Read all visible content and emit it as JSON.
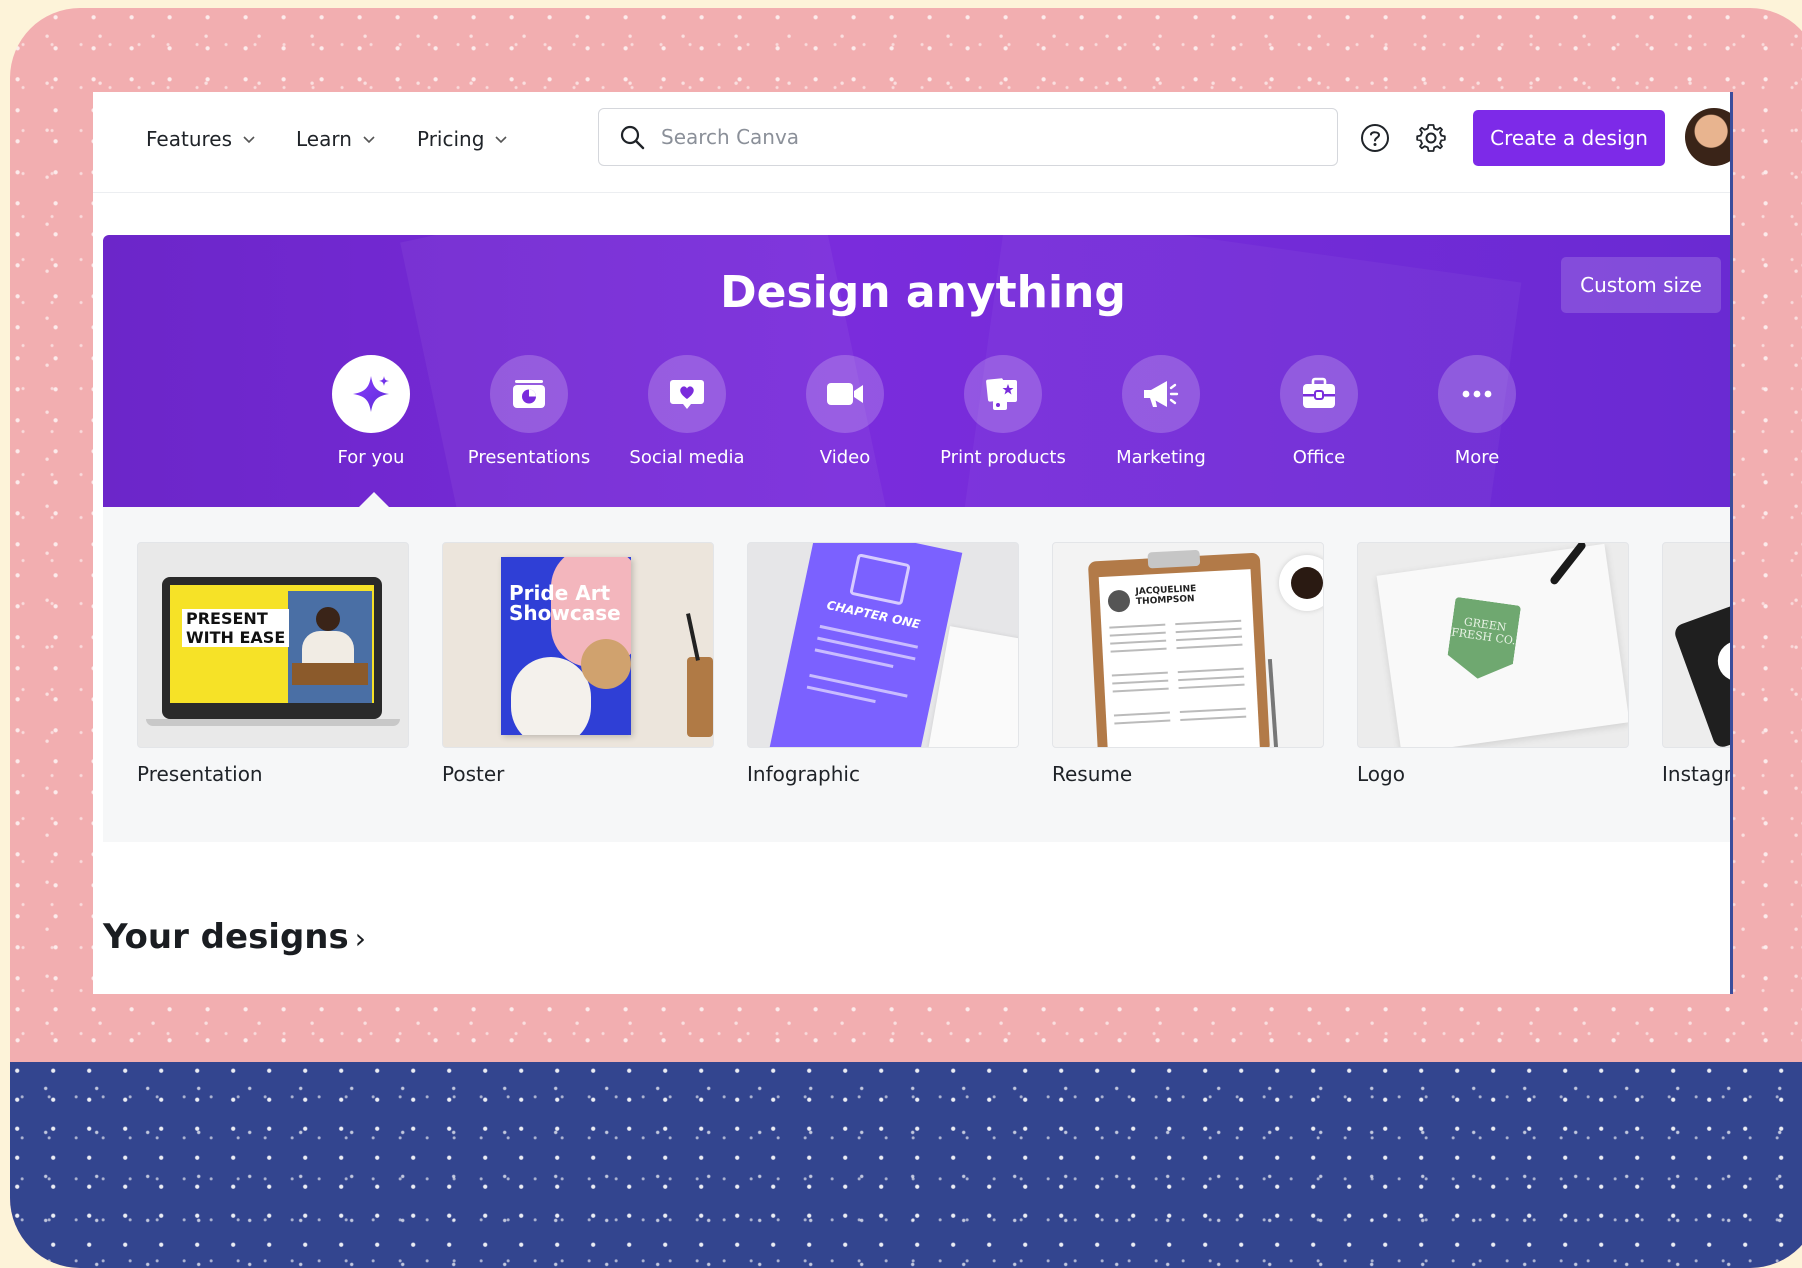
{
  "nav": {
    "items": [
      {
        "label": "Features"
      },
      {
        "label": "Learn"
      },
      {
        "label": "Pricing"
      }
    ]
  },
  "search": {
    "placeholder": "Search Canva",
    "value": ""
  },
  "header": {
    "create_label": "Create a design"
  },
  "hero": {
    "title": "Design anything",
    "custom_size_label": "Custom size",
    "categories": [
      {
        "label": "For you",
        "icon": "sparkle-icon",
        "active": true
      },
      {
        "label": "Presentations",
        "icon": "presentation-icon"
      },
      {
        "label": "Social media",
        "icon": "heart-chat-icon"
      },
      {
        "label": "Video",
        "icon": "video-camera-icon"
      },
      {
        "label": "Print products",
        "icon": "print-products-icon"
      },
      {
        "label": "Marketing",
        "icon": "megaphone-icon"
      },
      {
        "label": "Office",
        "icon": "briefcase-icon"
      },
      {
        "label": "More",
        "icon": "more-dots-icon"
      }
    ]
  },
  "templates": [
    {
      "label": "Presentation",
      "thumb_text": "PRESENT\nWITH EASE"
    },
    {
      "label": "Poster",
      "thumb_text": "Pride Art\nShowcase"
    },
    {
      "label": "Infographic",
      "thumb_text": "CHAPTER ONE"
    },
    {
      "label": "Resume",
      "thumb_text": "JACQUELINE\nTHOMPSON"
    },
    {
      "label": "Logo",
      "thumb_text": "GREEN\nFRESH CO."
    },
    {
      "label": "Instagram"
    }
  ],
  "your_designs": {
    "title": "Your designs",
    "chevron": "›"
  },
  "colors": {
    "accent": "#7d2ae8",
    "hero_bg": "#7a2cdc",
    "frame_pink": "#f2aeb0",
    "frame_blue": "#33458f"
  }
}
